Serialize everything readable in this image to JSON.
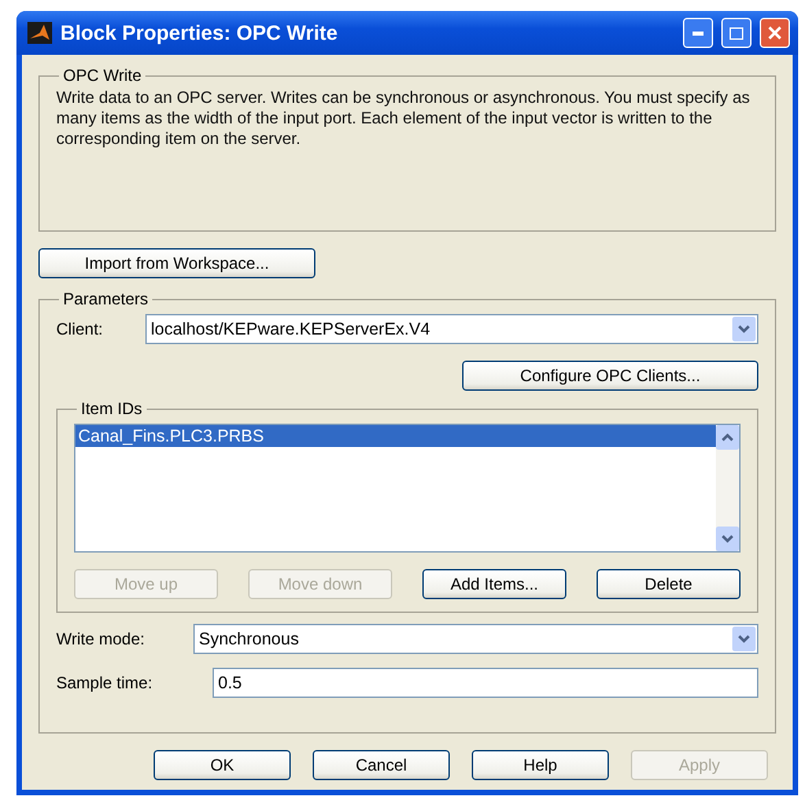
{
  "window": {
    "title": "Block Properties: OPC Write"
  },
  "description": {
    "legend": "OPC Write",
    "text": "Write data to an OPC server. Writes can be synchronous or asynchronous. You must specify as many items as the width of the input port. Each element of the input vector is written to the corresponding item on the server."
  },
  "import_button": {
    "label": "Import from Workspace..."
  },
  "parameters": {
    "legend": "Parameters",
    "client": {
      "label": "Client:",
      "value": "localhost/KEPware.KEPServerEx.V4"
    },
    "configure_button": {
      "label": "Configure OPC Clients..."
    },
    "item_ids": {
      "legend": "Item IDs",
      "items": [
        {
          "label": "Canal_Fins.PLC3.PRBS",
          "selected": true
        }
      ],
      "buttons": [
        {
          "label": "Move up",
          "disabled": true
        },
        {
          "label": "Move down",
          "disabled": true
        },
        {
          "label": "Add Items...",
          "disabled": false
        },
        {
          "label": "Delete",
          "disabled": false
        }
      ]
    },
    "write_mode": {
      "label": "Write mode:",
      "value": "Synchronous"
    },
    "sample_time": {
      "label": "Sample time:",
      "value": "0.5"
    }
  },
  "buttons": [
    {
      "label": "OK",
      "disabled": false
    },
    {
      "label": "Cancel",
      "disabled": false
    },
    {
      "label": "Help",
      "disabled": false
    },
    {
      "label": "Apply",
      "disabled": true
    }
  ]
}
